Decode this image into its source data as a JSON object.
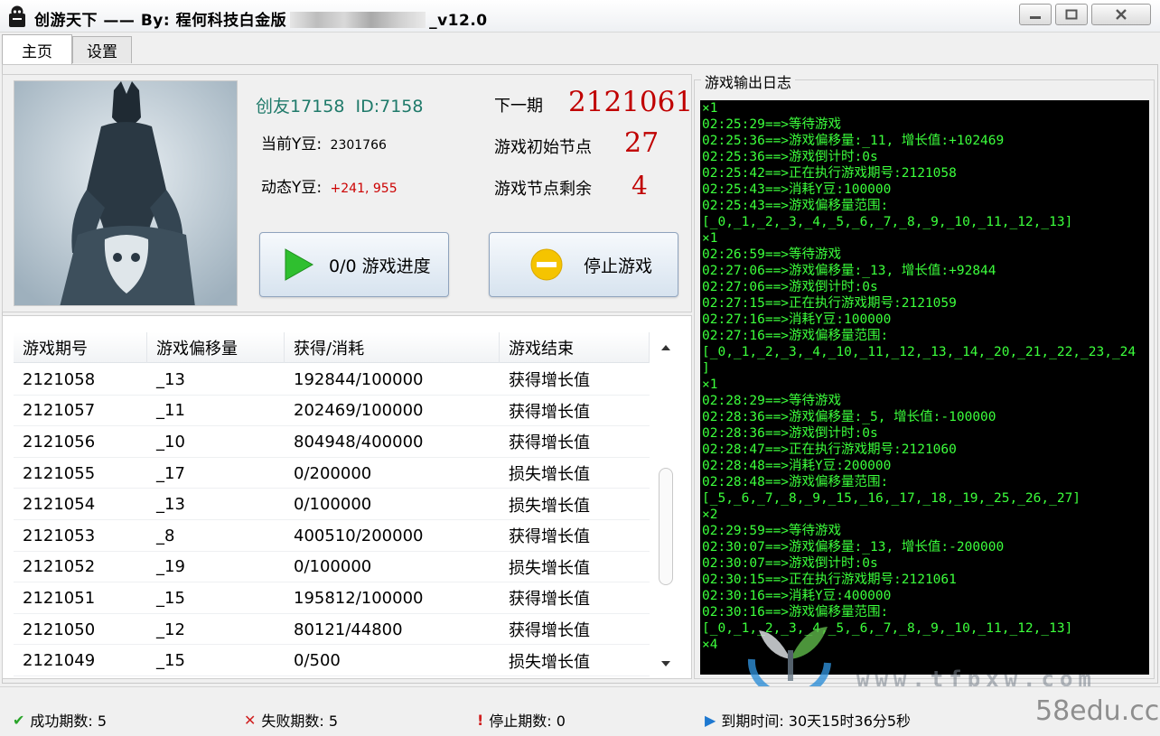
{
  "window": {
    "title_prefix": "创游天下 —— By: 程何科技白金版",
    "title_suffix": "_v12.0"
  },
  "tabs": [
    {
      "label": "主页",
      "active": true
    },
    {
      "label": "设置",
      "active": false
    }
  ],
  "user": {
    "name": "创友17158",
    "id": "ID:7158",
    "current_y_label": "当前Y豆:",
    "current_y_value": "2301766",
    "dynamic_y_label": "动态Y豆:",
    "dynamic_y_value": "+241, 955"
  },
  "game_status": {
    "next_label": "下一期",
    "next_value": "2121061",
    "start_node_label": "游戏初始节点",
    "start_node_value": "27",
    "remaining_label": "游戏节点剩余",
    "remaining_value": "4"
  },
  "buttons": {
    "progress_label": "0/0 游戏进度",
    "stop_label": "停止游戏"
  },
  "table": {
    "headers": [
      "游戏期号",
      "游戏偏移量",
      "获得/消耗",
      "游戏结束"
    ],
    "rows": [
      [
        "2121058",
        "_13",
        "192844/100000",
        "获得增长值"
      ],
      [
        "2121057",
        "_11",
        "202469/100000",
        "获得增长值"
      ],
      [
        "2121056",
        "_10",
        "804948/400000",
        "获得增长值"
      ],
      [
        "2121055",
        "_17",
        "0/200000",
        "损失增长值"
      ],
      [
        "2121054",
        "_13",
        "0/100000",
        "损失增长值"
      ],
      [
        "2121053",
        "_8",
        "400510/200000",
        "获得增长值"
      ],
      [
        "2121052",
        "_19",
        "0/100000",
        "损失增长值"
      ],
      [
        "2121051",
        "_15",
        "195812/100000",
        "获得增长值"
      ],
      [
        "2121050",
        "_12",
        "80121/44800",
        "获得增长值"
      ],
      [
        "2121049",
        "_15",
        "0/500",
        "损失增长值"
      ]
    ]
  },
  "log": {
    "title": "游戏输出日志",
    "lines": [
      "×1",
      "02:25:29==>等待游戏",
      "02:25:36==>游戏偏移量:_11, 增长值:+102469",
      "02:25:36==>游戏倒计时:0s",
      "02:25:42==>正在执行游戏期号:2121058",
      "02:25:43==>消耗Y豆:100000",
      "02:25:43==>游戏偏移量范围:",
      "[_0,_1,_2,_3,_4,_5,_6,_7,_8,_9,_10,_11,_12,_13]",
      "×1",
      "02:26:59==>等待游戏",
      "02:27:06==>游戏偏移量:_13, 增长值:+92844",
      "02:27:06==>游戏倒计时:0s",
      "02:27:15==>正在执行游戏期号:2121059",
      "02:27:16==>消耗Y豆:100000",
      "02:27:16==>游戏偏移量范围:",
      "[_0,_1,_2,_3,_4,_10,_11,_12,_13,_14,_20,_21,_22,_23,_24",
      "]",
      "×1",
      "02:28:29==>等待游戏",
      "02:28:36==>游戏偏移量:_5, 增长值:-100000",
      "02:28:36==>游戏倒计时:0s",
      "02:28:47==>正在执行游戏期号:2121060",
      "02:28:48==>消耗Y豆:200000",
      "02:28:48==>游戏偏移量范围:",
      "[_5,_6,_7,_8,_9,_15,_16,_17,_18,_19,_25,_26,_27]",
      "×2",
      "02:29:59==>等待游戏",
      "02:30:07==>游戏偏移量:_13, 增长值:-200000",
      "02:30:07==>游戏倒计时:0s",
      "02:30:15==>正在执行游戏期号:2121061",
      "02:30:16==>消耗Y豆:400000",
      "02:30:16==>游戏偏移量范围:",
      "[_0,_1,_2,_3,_4,_5,_6,_7,_8,_9,_10,_11,_12,_13]",
      "×4"
    ]
  },
  "status_bar": {
    "success": "成功期数: 5",
    "failure": "失败期数: 5",
    "stop": "停止期数: 0",
    "expire": "到期时间: 30天15时36分5秒"
  },
  "watermark": {
    "url": "www.tfpxw.com",
    "site": "58edu.cc"
  },
  "colors": {
    "user_name": "#1f7a6a",
    "big_value_red": "#c00000",
    "dynamic_value_red": "#cc0000",
    "log_text": "#3cff3c",
    "log_background": "#000000",
    "success_icon": "#2aa52a",
    "failure_icon": "#d02020",
    "play_icon": "#2fbf2f",
    "stop_icon": "#f5c400",
    "expire_icon": "#1e78d0"
  }
}
